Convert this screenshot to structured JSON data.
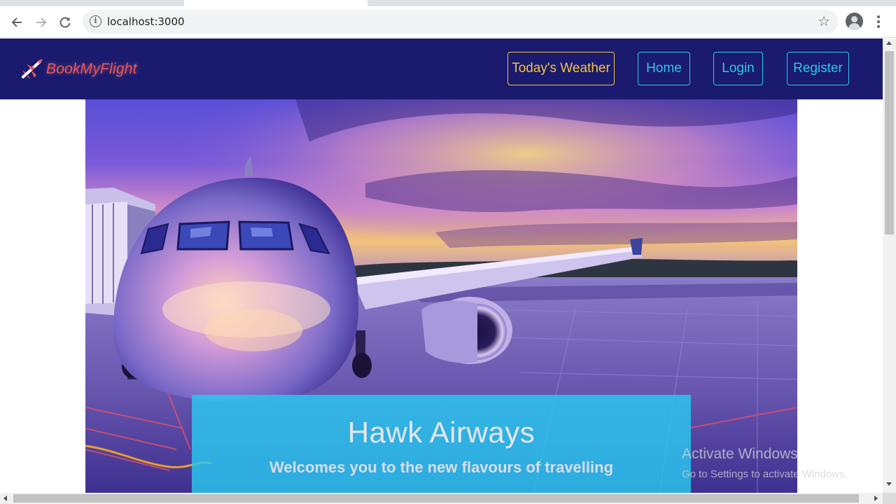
{
  "browser": {
    "url": "localhost:3000",
    "icons": {
      "back": "back-arrow-icon",
      "forward": "forward-arrow-icon",
      "reload": "reload-icon",
      "info": "site-info-icon",
      "bookmark": "bookmark-star-icon",
      "profile": "profile-icon",
      "menu": "more-vertical-icon"
    }
  },
  "navbar": {
    "brand": "BookMyFlight",
    "links": {
      "weather": "Today's Weather",
      "home": "Home",
      "login": "Login",
      "register": "Register"
    },
    "colors": {
      "background": "#1a1b6e",
      "brand_text": "#e8575b",
      "weather_accent": "#f5c242",
      "link_accent": "#2cc7f2"
    }
  },
  "hero": {
    "title": "Hawk Airways",
    "subtitle": "Welcomes you to the new flavours of travelling",
    "overlay_color": "#2ac8f0"
  },
  "watermark": {
    "title": "Activate Windows",
    "subtitle": "Go to Settings to activate Windows."
  }
}
